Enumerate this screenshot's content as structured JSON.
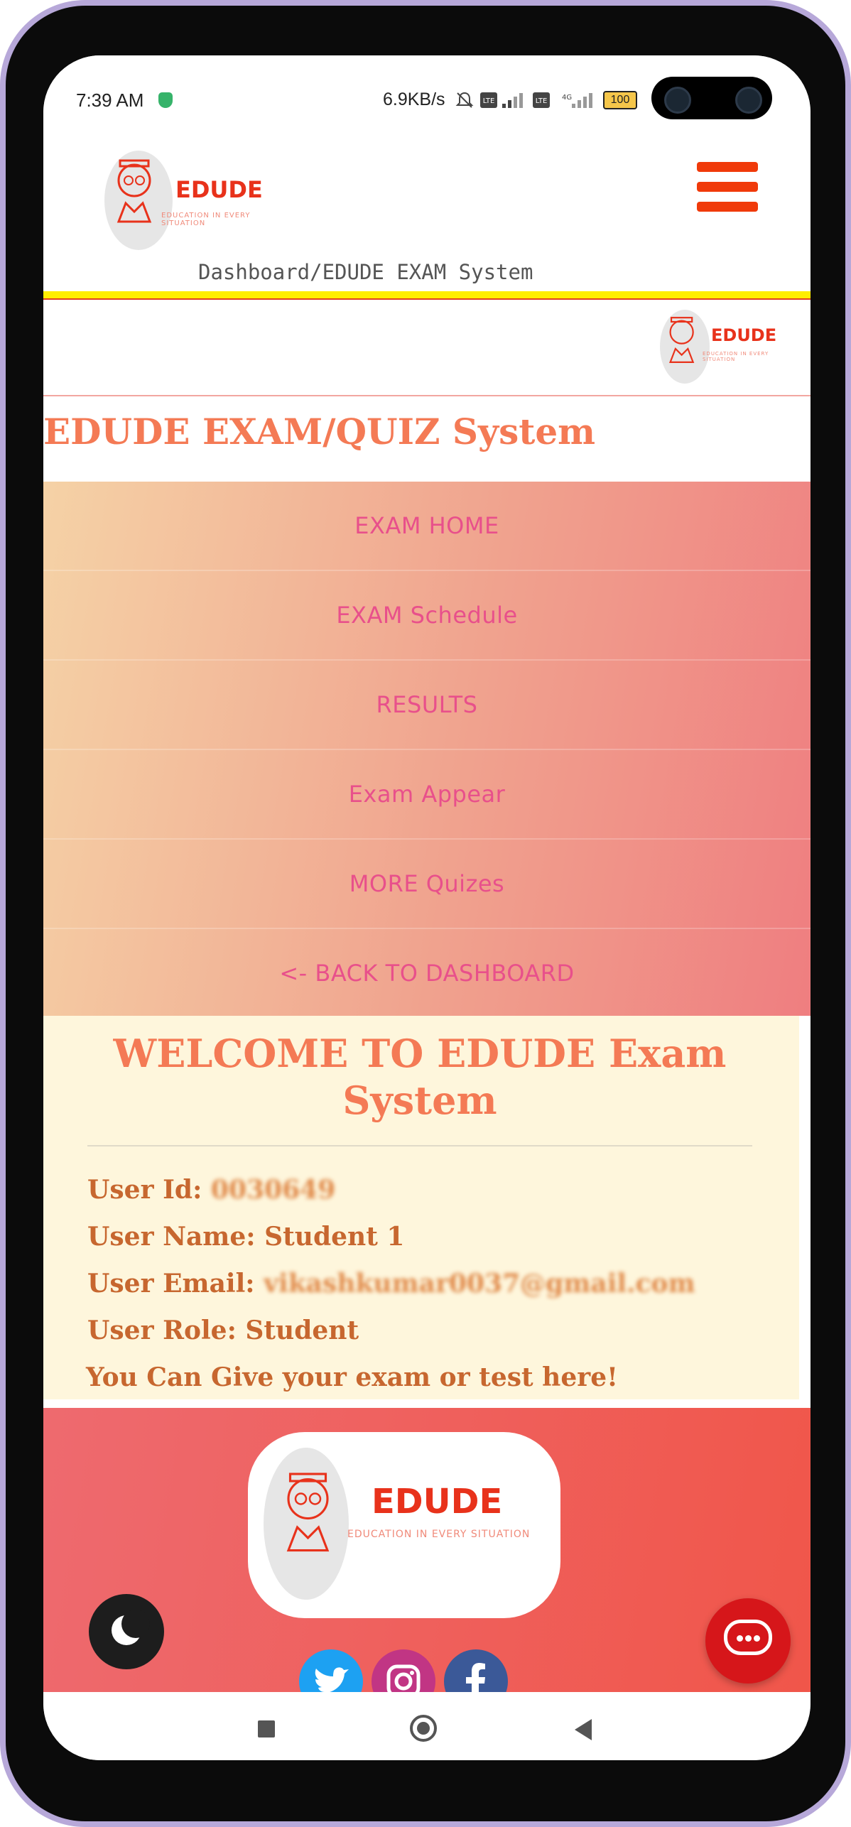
{
  "status_bar": {
    "time": "7:39 AM",
    "network_rate": "6.9KB/s",
    "battery": "100"
  },
  "header": {
    "logo_title": "EDUDE",
    "logo_tagline": "EDUCATION IN EVERY SITUATION",
    "breadcrumb": "Dashboard/EDUDE EXAM System"
  },
  "page": {
    "title": "EDUDE EXAM/QUIZ System"
  },
  "menu": {
    "items": [
      {
        "label": "EXAM HOME"
      },
      {
        "label": "EXAM Schedule"
      },
      {
        "label": "RESULTS"
      },
      {
        "label": "Exam Appear"
      },
      {
        "label": "MORE Quizes"
      },
      {
        "label": "<- BACK TO DASHBOARD"
      }
    ]
  },
  "welcome": {
    "title": "WELCOME TO EDUDE Exam System",
    "user_id_label": "User Id:",
    "user_id": "0030649",
    "user_name_label": "User Name:",
    "user_name": "Student 1",
    "user_email_label": "User Email:",
    "user_email": "vikashkumar0037@gmail.com",
    "user_role_label": "User Role:",
    "user_role": "Student",
    "note": "You Can Give your exam or test here!"
  },
  "footer": {
    "logo_title": "EDUDE",
    "logo_tagline": "EDUCATION IN EVERY SITUATION",
    "social": [
      {
        "icon": "twitter-icon",
        "color": "#1da1f2"
      },
      {
        "icon": "instagram-icon",
        "color": "#c13584"
      },
      {
        "icon": "facebook-icon",
        "color": "#3b5998"
      }
    ]
  },
  "colors": {
    "brand": "#e8321b",
    "accent": "#f47a55",
    "menu_text": "#e8508b",
    "welcome_bg": "#fef6dc"
  }
}
